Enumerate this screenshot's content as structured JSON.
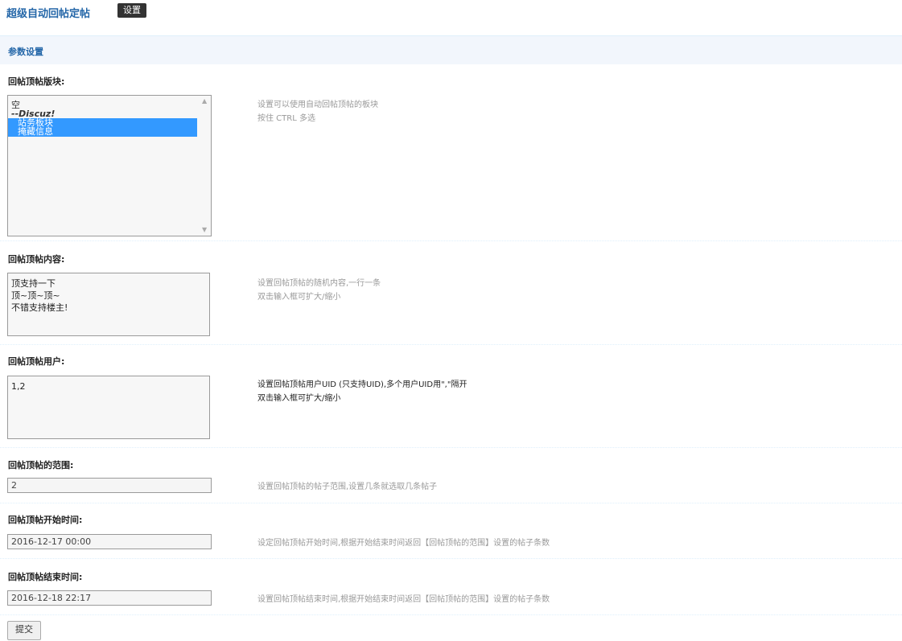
{
  "header": {
    "plugin_title": "超级自动回帖定帖",
    "tab_label": "设置"
  },
  "section": {
    "title": "参数设置"
  },
  "fields": {
    "forums": {
      "label": "回帖顶帖版块:",
      "options": [
        "空",
        "--Discuz!",
        "站务板块",
        "掩藏信息"
      ],
      "selected": [
        "站务板块",
        "掩藏信息"
      ],
      "hint_line1": "设置可以使用自动回帖顶帖的板块",
      "hint_line2": "按住 CTRL 多选"
    },
    "content": {
      "label": "回帖顶帖内容:",
      "value": "顶支持一下\n顶~顶~顶~\n不错支持楼主!",
      "hint_line1": "设置回帖顶帖的随机内容,一行一条",
      "hint_line2": "双击输入框可扩大/缩小"
    },
    "users": {
      "label": "回帖顶帖用户:",
      "value": "1,2",
      "hint_line1": "设置回帖顶帖用户UID (只支持UID),多个用户UID用\",\"隔开",
      "hint_line2": "双击输入框可扩大/缩小"
    },
    "range": {
      "label": "回帖顶帖的范围:",
      "value": "2",
      "hint": "设置回帖顶帖的帖子范围,设置几条就选取几条帖子"
    },
    "start_time": {
      "label": "回帖顶帖开始时间:",
      "value": "2016-12-17 00:00",
      "hint": "设定回帖顶帖开始时间,根据开始结束时间返回【回帖顶帖的范围】设置的帖子条数"
    },
    "end_time": {
      "label": "回帖顶帖结束时间:",
      "value": "2016-12-18 22:17",
      "hint": "设置回帖顶帖结束时间,根据开始结束时间返回【回帖顶帖的范围】设置的帖子条数"
    }
  },
  "submit_label": "提交",
  "colors": {
    "accent": "#2366A8",
    "header_bg": "#F2F6FC",
    "selected_option": "#3399FF"
  }
}
